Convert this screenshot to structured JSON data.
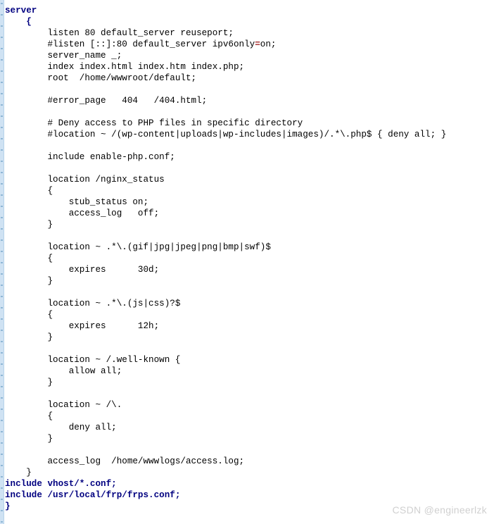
{
  "document": {
    "kind": "nginx-config-file",
    "gutter_color": "#cfe2f3",
    "keyword_color": "#000080",
    "text_color": "#000000",
    "operator_color": "#a52a2a",
    "background_color": "#ffffff"
  },
  "watermark": {
    "text": "CSDN @engineerlzk",
    "color": "#d0d0d0"
  },
  "code": {
    "lines": [
      {
        "id": "line-1",
        "indent": 0,
        "style": "keyword",
        "text": "server"
      },
      {
        "id": "line-2",
        "indent": 0,
        "style": "keyword",
        "text": "    {"
      },
      {
        "id": "line-3",
        "indent": 0,
        "style": "plain",
        "text": "        listen 80 default_server reuseport;"
      },
      {
        "id": "line-4",
        "indent": 0,
        "style": "eq-split",
        "text": "        #listen [::]:80 default_server ipv6only",
        "op": "=",
        "text2": "on;"
      },
      {
        "id": "line-5",
        "indent": 0,
        "style": "plain",
        "text": "        server_name _;"
      },
      {
        "id": "line-6",
        "indent": 0,
        "style": "plain",
        "text": "        index index.html index.htm index.php;"
      },
      {
        "id": "line-7",
        "indent": 0,
        "style": "plain",
        "text": "        root  /home/wwwroot/default;"
      },
      {
        "id": "line-8",
        "indent": 0,
        "style": "plain",
        "text": ""
      },
      {
        "id": "line-9",
        "indent": 0,
        "style": "plain",
        "text": "        #error_page   404   /404.html;"
      },
      {
        "id": "line-10",
        "indent": 0,
        "style": "plain",
        "text": ""
      },
      {
        "id": "line-11",
        "indent": 0,
        "style": "plain",
        "text": "        # Deny access to PHP files in specific directory"
      },
      {
        "id": "line-12",
        "indent": 0,
        "style": "plain",
        "text": "        #location ~ /(wp-content|uploads|wp-includes|images)/.*\\.php$ { deny all; }"
      },
      {
        "id": "line-13",
        "indent": 0,
        "style": "plain",
        "text": ""
      },
      {
        "id": "line-14",
        "indent": 0,
        "style": "plain",
        "text": "        include enable-php.conf;"
      },
      {
        "id": "line-15",
        "indent": 0,
        "style": "plain",
        "text": ""
      },
      {
        "id": "line-16",
        "indent": 0,
        "style": "plain",
        "text": "        location /nginx_status"
      },
      {
        "id": "line-17",
        "indent": 0,
        "style": "plain",
        "text": "        {"
      },
      {
        "id": "line-18",
        "indent": 0,
        "style": "plain",
        "text": "            stub_status on;"
      },
      {
        "id": "line-19",
        "indent": 0,
        "style": "plain",
        "text": "            access_log   off;"
      },
      {
        "id": "line-20",
        "indent": 0,
        "style": "plain",
        "text": "        }"
      },
      {
        "id": "line-21",
        "indent": 0,
        "style": "plain",
        "text": ""
      },
      {
        "id": "line-22",
        "indent": 0,
        "style": "plain",
        "text": "        location ~ .*\\.(gif|jpg|jpeg|png|bmp|swf)$"
      },
      {
        "id": "line-23",
        "indent": 0,
        "style": "plain",
        "text": "        {"
      },
      {
        "id": "line-24",
        "indent": 0,
        "style": "plain",
        "text": "            expires      30d;"
      },
      {
        "id": "line-25",
        "indent": 0,
        "style": "plain",
        "text": "        }"
      },
      {
        "id": "line-26",
        "indent": 0,
        "style": "plain",
        "text": ""
      },
      {
        "id": "line-27",
        "indent": 0,
        "style": "plain",
        "text": "        location ~ .*\\.(js|css)?$"
      },
      {
        "id": "line-28",
        "indent": 0,
        "style": "plain",
        "text": "        {"
      },
      {
        "id": "line-29",
        "indent": 0,
        "style": "plain",
        "text": "            expires      12h;"
      },
      {
        "id": "line-30",
        "indent": 0,
        "style": "plain",
        "text": "        }"
      },
      {
        "id": "line-31",
        "indent": 0,
        "style": "plain",
        "text": ""
      },
      {
        "id": "line-32",
        "indent": 0,
        "style": "plain",
        "text": "        location ~ /.well-known {"
      },
      {
        "id": "line-33",
        "indent": 0,
        "style": "plain",
        "text": "            allow all;"
      },
      {
        "id": "line-34",
        "indent": 0,
        "style": "plain",
        "text": "        }"
      },
      {
        "id": "line-35",
        "indent": 0,
        "style": "plain",
        "text": ""
      },
      {
        "id": "line-36",
        "indent": 0,
        "style": "plain",
        "text": "        location ~ /\\."
      },
      {
        "id": "line-37",
        "indent": 0,
        "style": "plain",
        "text": "        {"
      },
      {
        "id": "line-38",
        "indent": 0,
        "style": "plain",
        "text": "            deny all;"
      },
      {
        "id": "line-39",
        "indent": 0,
        "style": "plain",
        "text": "        }"
      },
      {
        "id": "line-40",
        "indent": 0,
        "style": "plain",
        "text": ""
      },
      {
        "id": "line-41",
        "indent": 0,
        "style": "plain",
        "text": "        access_log  /home/wwwlogs/access.log;"
      },
      {
        "id": "line-42",
        "indent": 0,
        "style": "plain",
        "text": "    }"
      },
      {
        "id": "line-43",
        "indent": 0,
        "style": "keyword",
        "text": "include vhost/*.conf;"
      },
      {
        "id": "line-44",
        "indent": 0,
        "style": "keyword",
        "text": "include /usr/local/frp/frps.conf;"
      },
      {
        "id": "line-45",
        "indent": 0,
        "style": "keyword",
        "text": "}"
      }
    ]
  }
}
